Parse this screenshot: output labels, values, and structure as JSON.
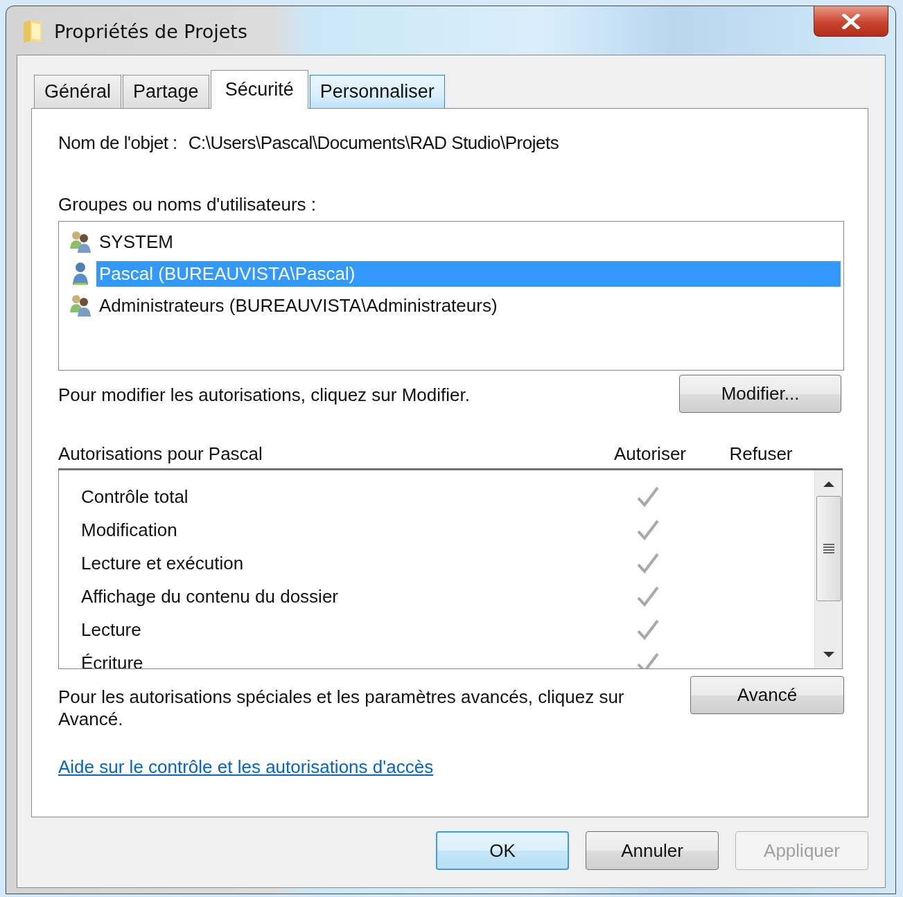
{
  "window": {
    "title": "Propriétés de Projets"
  },
  "tabs": [
    {
      "label": "Général",
      "selected": false
    },
    {
      "label": "Partage",
      "selected": false
    },
    {
      "label": "Sécurité",
      "selected": true
    },
    {
      "label": "Personnaliser",
      "selected": false
    }
  ],
  "object_name": {
    "label": "Nom de l'objet :",
    "value": "C:\\Users\\Pascal\\Documents\\RAD Studio\\Projets"
  },
  "groups": {
    "label": "Groupes ou noms d'utilisateurs :",
    "items": [
      {
        "name": "SYSTEM",
        "kind": "group",
        "selected": false
      },
      {
        "name": "Pascal (BUREAUVISTA\\Pascal)",
        "kind": "user",
        "selected": true
      },
      {
        "name": "Administrateurs (BUREAUVISTA\\Administrateurs)",
        "kind": "group",
        "selected": false
      }
    ]
  },
  "modify": {
    "hint": "Pour modifier les autorisations, cliquez sur Modifier.",
    "button": "Modifier..."
  },
  "permissions": {
    "label": "Autorisations pour Pascal",
    "allow_header": "Autoriser",
    "deny_header": "Refuser",
    "rows": [
      {
        "name": "Contrôle total",
        "allow": true,
        "deny": false
      },
      {
        "name": "Modification",
        "allow": true,
        "deny": false
      },
      {
        "name": "Lecture et exécution",
        "allow": true,
        "deny": false
      },
      {
        "name": "Affichage du contenu du dossier",
        "allow": true,
        "deny": false
      },
      {
        "name": "Lecture",
        "allow": true,
        "deny": false
      },
      {
        "name": "Écriture",
        "allow": true,
        "deny": false
      }
    ]
  },
  "advanced": {
    "hint": "Pour les autorisations spéciales et les paramètres avancés, cliquez sur Avancé.",
    "button": "Avancé"
  },
  "help_link": "Aide sur le contrôle et les autorisations d'accès",
  "buttons": [
    {
      "label": "OK",
      "default": true,
      "disabled": false
    },
    {
      "label": "Annuler",
      "default": false,
      "disabled": false
    },
    {
      "label": "Appliquer",
      "default": false,
      "disabled": true
    }
  ]
}
